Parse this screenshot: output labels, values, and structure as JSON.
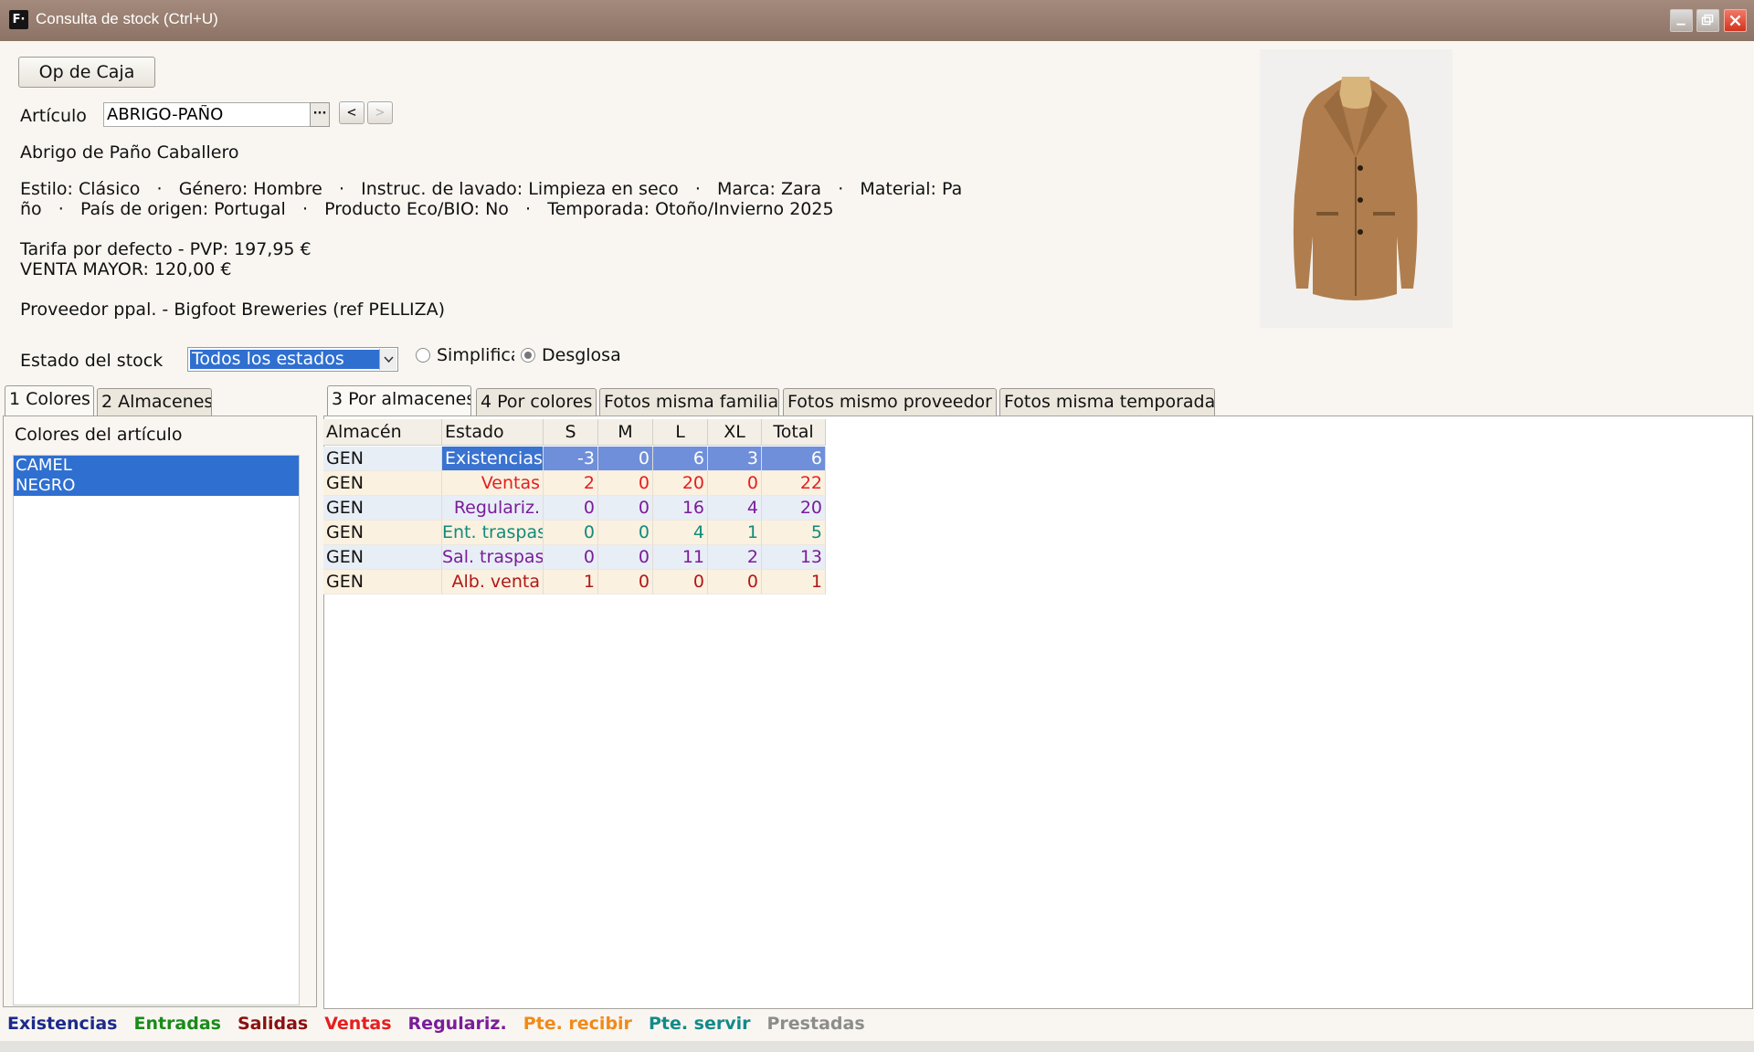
{
  "window": {
    "title": "Consulta de stock (Ctrl+U)",
    "icon_text": "F·"
  },
  "op_caja_label": "Op de Caja",
  "articulo": {
    "label": "Artículo",
    "value": "ABRIGO-PAÑO",
    "dots": "···",
    "prev": "<",
    "next": ">"
  },
  "description": "Abrigo de Paño Caballero",
  "attributes": {
    "line1": "Estilo: Clásico   ·   Género: Hombre   ·   Instruc. de lavado: Limpieza en seco   ·   Marca: Zara   ·   Material: Pa",
    "line2": "ño   ·   País de origen: Portugal   ·   Producto Eco/BIO: No   ·   Temporada: Otoño/Invierno 2025"
  },
  "tarifa": {
    "line1": "Tarifa por defecto - PVP: 197,95 €",
    "line2": "VENTA MAYOR: 120,00 €"
  },
  "proveedor": "Proveedor ppal. - Bigfoot Breweries (ref PELLIZA)",
  "stock_state": {
    "label": "Estado del stock",
    "selected": "Todos los estados",
    "option_simplifica": "Simplifica",
    "option_desglosa": "Desglosa"
  },
  "left_tabs": [
    "1 Colores",
    "2 Almacenes"
  ],
  "right_tabs": [
    "3 Por almacenes",
    "4 Por colores",
    "Fotos misma familia",
    "Fotos mismo proveedor",
    "Fotos misma temporada"
  ],
  "colors_panel": {
    "title": "Colores del artículo",
    "items": [
      "CAMEL",
      "NEGRO"
    ]
  },
  "table": {
    "headers": [
      "Almacén",
      "Estado",
      "S",
      "M",
      "L",
      "XL",
      "Total"
    ],
    "rows": [
      {
        "almacen": "GEN",
        "estado": "Existencias",
        "s": "-3",
        "m": "0",
        "l": "6",
        "xl": "3",
        "total": "6",
        "color": "#ffffff",
        "highlight": true
      },
      {
        "almacen": "GEN",
        "estado": "Ventas",
        "s": "2",
        "m": "0",
        "l": "20",
        "xl": "0",
        "total": "22",
        "color": "#e41f1f"
      },
      {
        "almacen": "GEN",
        "estado": "Regulariz.",
        "s": "0",
        "m": "0",
        "l": "16",
        "xl": "4",
        "total": "20",
        "color": "#7a1c9a"
      },
      {
        "almacen": "GEN",
        "estado": "Ent. traspas",
        "s": "0",
        "m": "0",
        "l": "4",
        "xl": "1",
        "total": "5",
        "color": "#128a7a"
      },
      {
        "almacen": "GEN",
        "estado": "Sal. traspas",
        "s": "0",
        "m": "0",
        "l": "11",
        "xl": "2",
        "total": "13",
        "color": "#7a1c9a"
      },
      {
        "almacen": "GEN",
        "estado": "Alb. venta",
        "s": "1",
        "m": "0",
        "l": "0",
        "xl": "0",
        "total": "1",
        "color": "#b01818"
      }
    ]
  },
  "legend": [
    {
      "label": "Existencias",
      "color": "#1c2a8c"
    },
    {
      "label": "Entradas",
      "color": "#1a8a1a"
    },
    {
      "label": "Salidas",
      "color": "#8a1010"
    },
    {
      "label": "Ventas",
      "color": "#e41f1f"
    },
    {
      "label": "Regulariz.",
      "color": "#7a1c9a"
    },
    {
      "label": "Pte. recibir",
      "color": "#f08a1a"
    },
    {
      "label": "Pte. servir",
      "color": "#128a8a"
    },
    {
      "label": "Prestadas",
      "color": "#8c8c8c"
    }
  ]
}
